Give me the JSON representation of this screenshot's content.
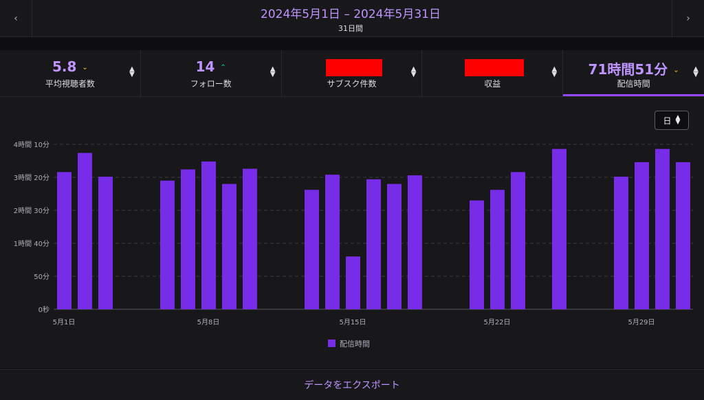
{
  "header": {
    "date_range": "2024年5月1日 – 2024年5月31日",
    "period_length": "31日間",
    "prev_icon": "chevron-left-icon",
    "next_icon": "chevron-right-icon"
  },
  "metrics": [
    {
      "value": "5.8",
      "trend": "down",
      "label": "平均視聴者数",
      "redacted": false
    },
    {
      "value": "14",
      "trend": "up",
      "label": "フォロー数",
      "redacted": false
    },
    {
      "value": "",
      "trend": "",
      "label": "サブスク件数",
      "redacted": true
    },
    {
      "value": "",
      "trend": "",
      "label": "収益",
      "redacted": true
    },
    {
      "value": "71時間51分",
      "trend": "down",
      "label": "配信時間",
      "redacted": false,
      "active": true
    }
  ],
  "period_select": {
    "value": "日"
  },
  "export": {
    "label": "データをエクスポート"
  },
  "colors": {
    "accent": "#9147ff",
    "bar": "#772ce8",
    "up": "#00c896",
    "down": "#e8a23a"
  },
  "chart_data": {
    "type": "bar",
    "x": [
      "5月1日",
      "5月2日",
      "5月3日",
      "5月4日",
      "5月5日",
      "5月6日",
      "5月7日",
      "5月8日",
      "5月9日",
      "5月10日",
      "5月11日",
      "5月12日",
      "5月13日",
      "5月14日",
      "5月15日",
      "5月16日",
      "5月17日",
      "5月18日",
      "5月19日",
      "5月20日",
      "5月21日",
      "5月22日",
      "5月23日",
      "5月24日",
      "5月25日",
      "5月26日",
      "5月27日",
      "5月28日",
      "5月29日",
      "5月30日",
      "5月31日"
    ],
    "xticks": [
      "5月1日",
      "5月8日",
      "5月15日",
      "5月22日",
      "5月29日"
    ],
    "series": [
      {
        "name": "配信時間",
        "unit": "minutes",
        "values": [
          208,
          237,
          201,
          0,
          0,
          195,
          212,
          224,
          190,
          213,
          0,
          0,
          181,
          204,
          80,
          197,
          190,
          203,
          0,
          0,
          165,
          181,
          208,
          0,
          243,
          0,
          0,
          201,
          223,
          243,
          223
        ]
      }
    ],
    "yticks": [
      "0秒",
      "50分",
      "1時間 40分",
      "2時間 30分",
      "3時間 20分",
      "4時間 10分"
    ],
    "ylim": [
      0,
      250
    ],
    "grid": true,
    "legend": "bottom"
  }
}
